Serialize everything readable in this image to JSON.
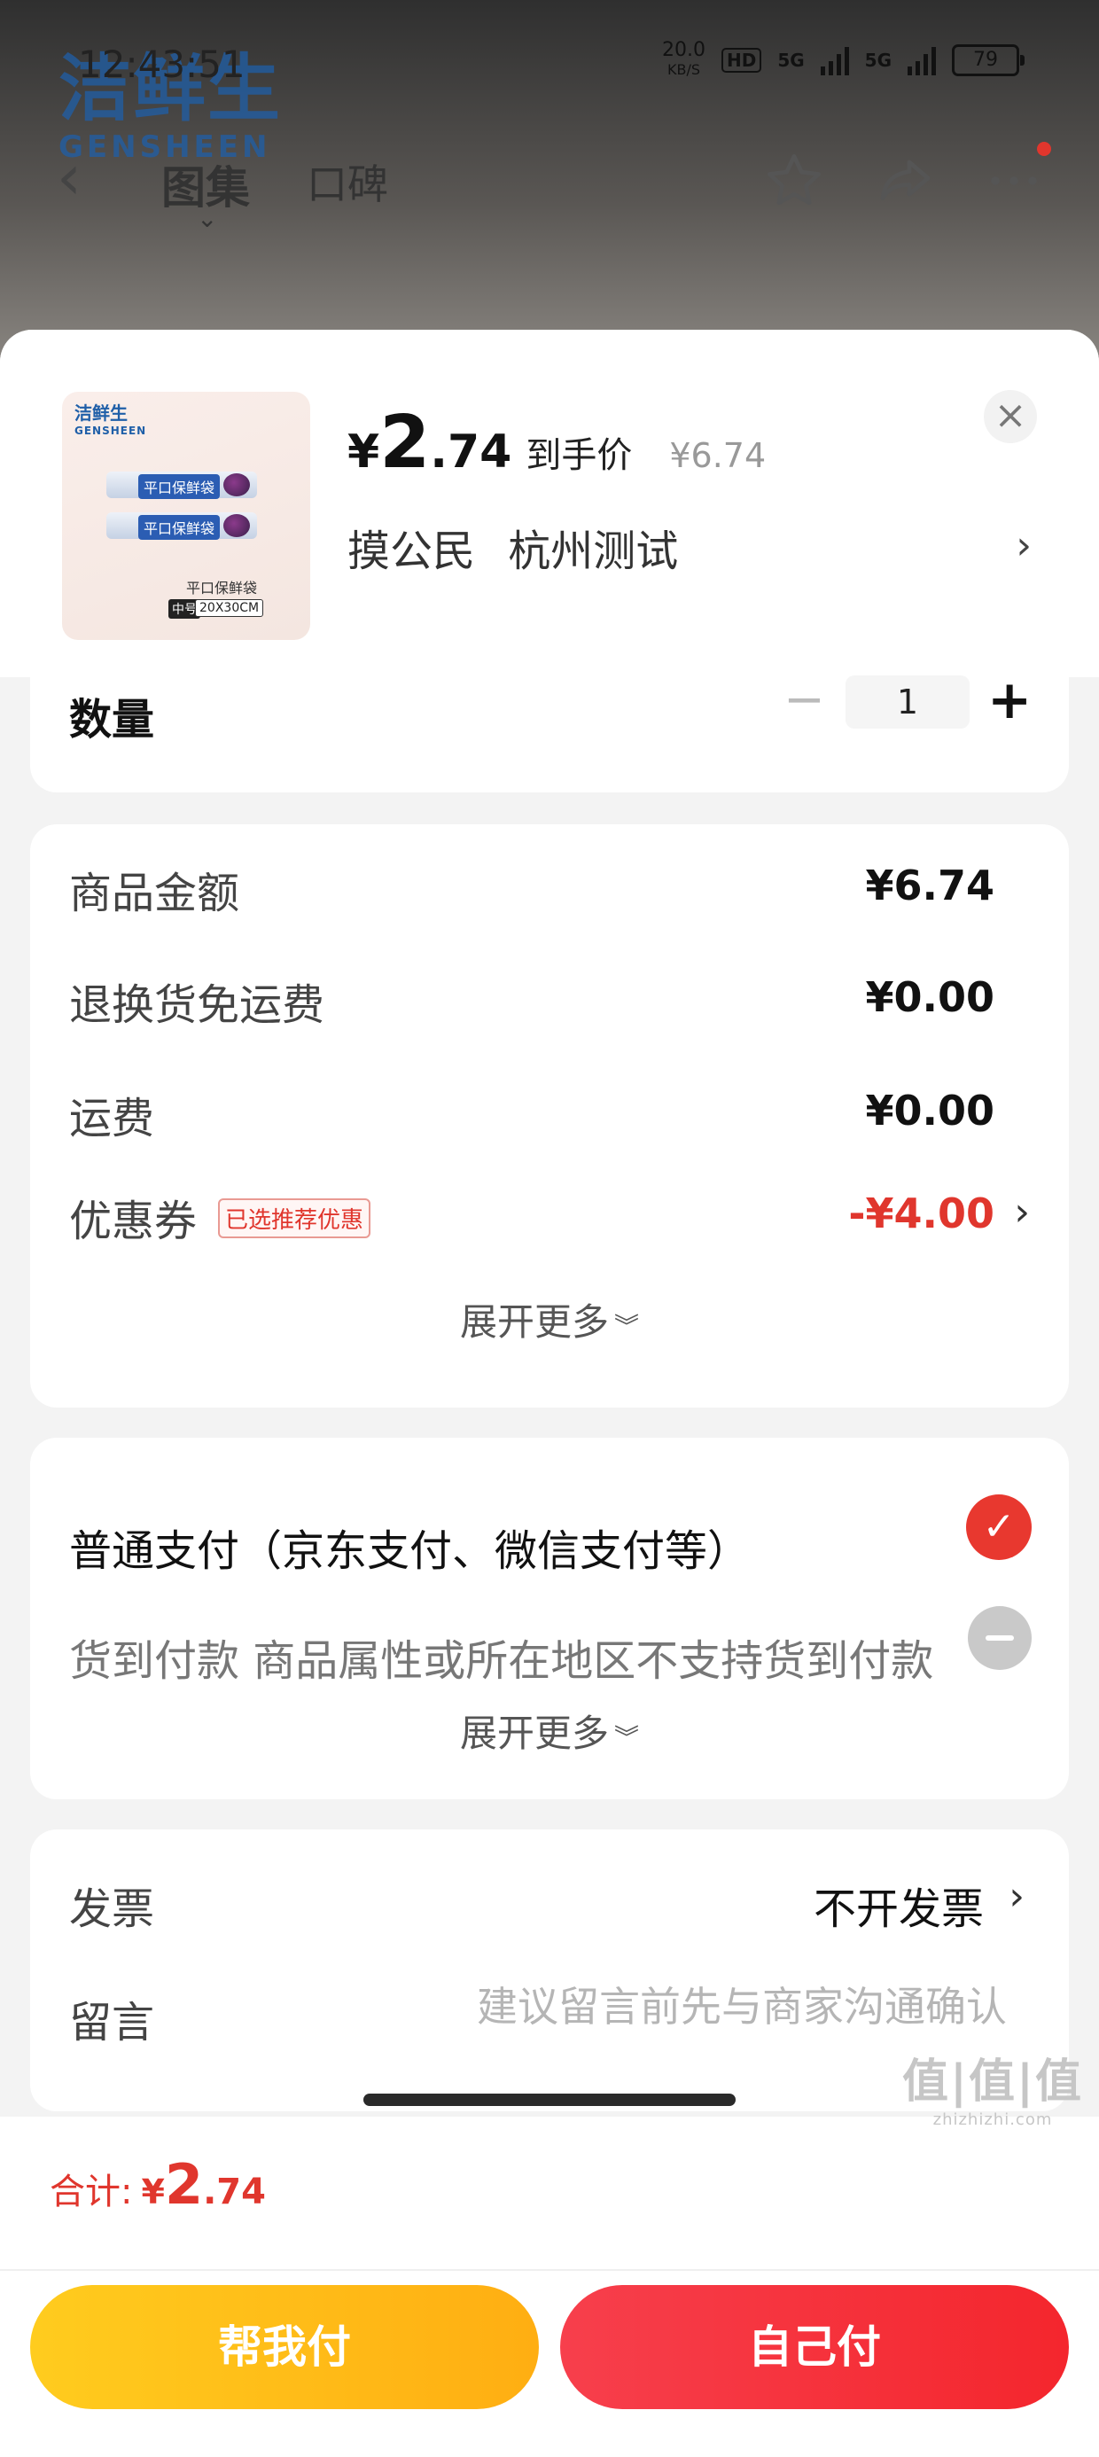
{
  "status_bar": {
    "time": "12:43:51",
    "net_speed": "20.0",
    "net_unit": "KB/S",
    "hd": "HD",
    "sig1": "5G",
    "sig2": "5G",
    "battery": "79"
  },
  "background": {
    "logo_cn": "洁鲜生",
    "logo_en": "GENSHEEN",
    "tabs": [
      {
        "label": "图集",
        "active": true
      },
      {
        "label": "口碑",
        "active": false
      }
    ],
    "icons": [
      "back-arrow-icon",
      "star-icon",
      "share-icon",
      "more-icon"
    ]
  },
  "product": {
    "thumb_logo_cn": "洁鲜生",
    "thumb_logo_en": "GENSHEEN",
    "thumb_roll_label": "平口保鲜袋",
    "thumb_bag_label": "平口保鲜袋",
    "thumb_mid": "中号",
    "thumb_size": "20X30CM",
    "price_symbol": "¥",
    "price_int": "2",
    "price_dec": ".74",
    "price_tag": "到手价",
    "original_price": "¥6.74",
    "receiver_name": "摸公民",
    "receiver_addr": "杭州测试"
  },
  "quantity": {
    "label": "数量",
    "value": "1",
    "minus": "−",
    "plus": "+"
  },
  "amounts": [
    {
      "label": "商品金额",
      "value": "¥6.74"
    },
    {
      "label": "退换货免运费",
      "value": "¥0.00"
    },
    {
      "label": "运费",
      "value": "¥0.00"
    },
    {
      "label": "优惠券",
      "badge": "已选推荐优惠",
      "value": "-¥4.00"
    }
  ],
  "expand_more": "展开更多",
  "payment": {
    "options": [
      {
        "label": "普通支付（京东支付、微信支付等）",
        "selected": true
      },
      {
        "label": "货到付款 商品属性或所在地区不支持货到付款",
        "selected": false
      }
    ],
    "expand_more": "展开更多"
  },
  "invoice": {
    "label": "发票",
    "value": "不开发票"
  },
  "note": {
    "label": "留言",
    "placeholder": "建议留言前先与商家沟通确认"
  },
  "total": {
    "label": "合计:",
    "symbol": "¥",
    "int": "2",
    "dec": ".74"
  },
  "buttons": {
    "help_pay": "帮我付",
    "self_pay": "自己付"
  },
  "watermark": {
    "main": "值|值|值",
    "sub": "zhizhizhi.com"
  },
  "colors": {
    "accent_red": "#e0362d",
    "help_button": "#ffbb18",
    "self_button": "#f5303a"
  }
}
